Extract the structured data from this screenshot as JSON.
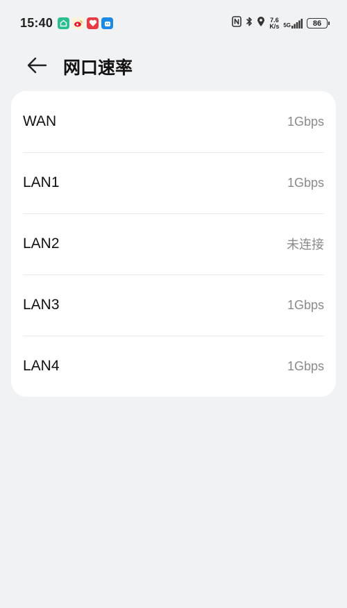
{
  "status_bar": {
    "time": "15:40",
    "app_icons": [
      "mi-home-icon",
      "weibo-icon",
      "heart-app-icon",
      "bot-app-icon"
    ],
    "network_speed_value": "7.6",
    "network_speed_unit": "K/s",
    "network_type": "5G",
    "battery": "86"
  },
  "header": {
    "title": "网口速率"
  },
  "ports": [
    {
      "name": "WAN",
      "speed": "1Gbps"
    },
    {
      "name": "LAN1",
      "speed": "1Gbps"
    },
    {
      "name": "LAN2",
      "speed": "未连接"
    },
    {
      "name": "LAN3",
      "speed": "1Gbps"
    },
    {
      "name": "LAN4",
      "speed": "1Gbps"
    }
  ],
  "colors": {
    "background": "#f1f2f4",
    "card": "#ffffff",
    "value_text": "#8a8a8a"
  }
}
